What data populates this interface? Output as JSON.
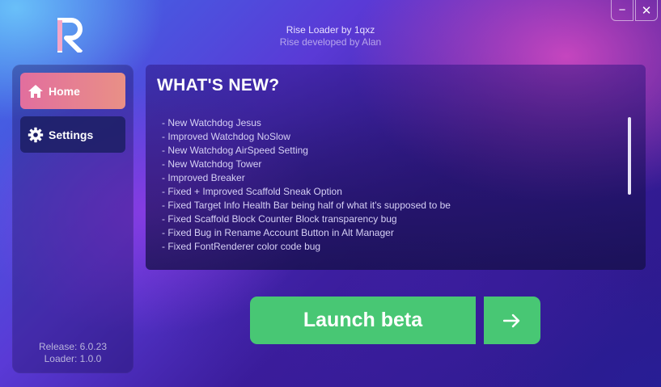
{
  "header": {
    "title": "Rise Loader by 1qxz",
    "subtitle": "Rise developed by Alan"
  },
  "window_controls": {
    "minimize": "−",
    "close": "✕"
  },
  "sidebar": {
    "items": [
      {
        "label": "Home",
        "icon": "home-icon",
        "active": true
      },
      {
        "label": "Settings",
        "icon": "gear-icon",
        "active": false
      }
    ],
    "release": "Release: 6.0.23",
    "loader": "Loader: 1.0.0"
  },
  "news": {
    "title": "WHAT'S NEW?",
    "items": [
      "- New Watchdog Jesus",
      "- Improved Watchdog NoSlow",
      "- New Watchdog AirSpeed Setting",
      "- New Watchdog Tower",
      "- Improved Breaker",
      "- Fixed + Improved Scaffold Sneak Option",
      "- Fixed Target Info Health Bar being half of what it's supposed to be",
      "- Fixed Scaffold Block Counter Block transparency bug",
      "- Fixed Bug in Rename Account Button in Alt Manager",
      "- Fixed FontRenderer color code bug"
    ]
  },
  "launch": {
    "label": "Launch beta",
    "arrow_icon": "arrow-right-icon"
  },
  "colors": {
    "accent_green": "#48c774",
    "home_active": "#e26e9e",
    "settings_bg": "#1c1e64"
  }
}
